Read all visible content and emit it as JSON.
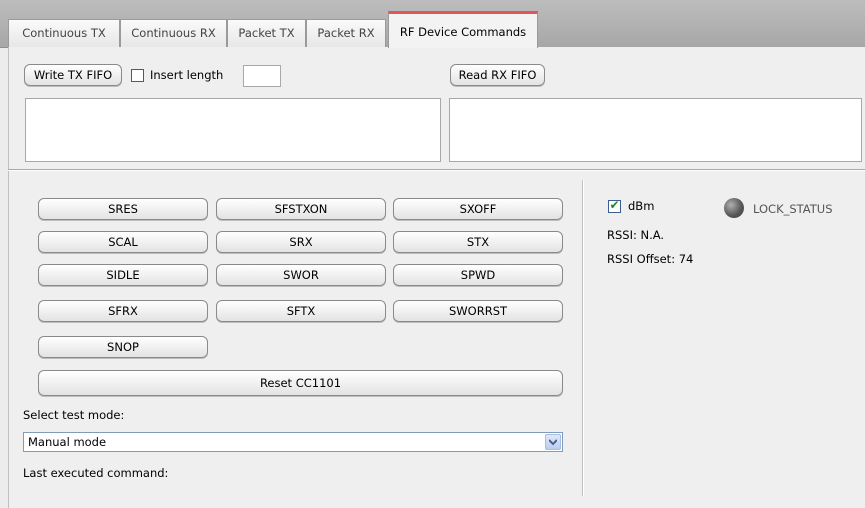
{
  "tabs": [
    {
      "label": "Continuous TX"
    },
    {
      "label": "Continuous RX"
    },
    {
      "label": "Packet TX"
    },
    {
      "label": "Packet RX"
    },
    {
      "label": "RF Device Commands"
    }
  ],
  "active_tab": "RF Device Commands",
  "fifo": {
    "write_button": "Write TX FIFO",
    "insert_length_label": "Insert length",
    "insert_length_checked": false,
    "insert_length_value": "",
    "read_button": "Read RX FIFO",
    "tx_text": "",
    "rx_text": ""
  },
  "commands": {
    "row1": [
      "SRES",
      "SFSTXON",
      "SXOFF"
    ],
    "row2": [
      "SCAL",
      "SRX",
      "STX"
    ],
    "row3": [
      "SIDLE",
      "SWOR",
      "SPWD"
    ],
    "row4": [
      "SFRX",
      "SFTX",
      "SWORRST"
    ],
    "row5": [
      "SNOP"
    ],
    "reset": "Reset CC1101"
  },
  "test_mode": {
    "label": "Select test mode:",
    "selected": "Manual mode",
    "last_cmd_label": "Last executed command:"
  },
  "status": {
    "dbm_label": "dBm",
    "dbm_checked": true,
    "lock_label": "LOCK_STATUS",
    "rssi": "RSSI: N.A.",
    "rssi_offset": "RSSI Offset: 74"
  }
}
